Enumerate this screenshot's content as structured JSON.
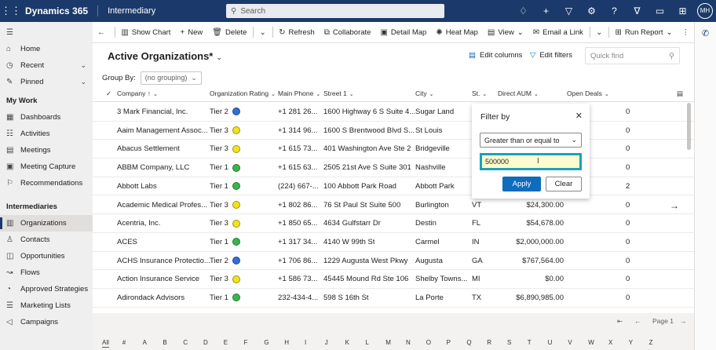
{
  "topbar": {
    "brand": "Dynamics 365",
    "app_name": "Intermediary",
    "search_placeholder": "Search",
    "icons": [
      "lightbulb-icon",
      "plus-icon",
      "filter-icon",
      "gear-icon",
      "help-icon",
      "chevron-down-icon",
      "chat-icon",
      "grid-icon"
    ],
    "avatar_initials": "MH"
  },
  "sidebar": {
    "top_items": [
      {
        "label": "Home",
        "icon": "home-icon"
      },
      {
        "label": "Recent",
        "icon": "clock-icon",
        "has_chevron": true
      },
      {
        "label": "Pinned",
        "icon": "pin-icon",
        "has_chevron": true
      }
    ],
    "sections": [
      {
        "title": "My Work",
        "items": [
          {
            "label": "Dashboards",
            "icon": "dashboard-icon"
          },
          {
            "label": "Activities",
            "icon": "activities-icon"
          },
          {
            "label": "Meetings",
            "icon": "calendar-icon"
          },
          {
            "label": "Meeting Capture",
            "icon": "capture-icon"
          },
          {
            "label": "Recommendations",
            "icon": "recommendation-icon"
          }
        ]
      },
      {
        "title": "Intermediaries",
        "items": [
          {
            "label": "Organizations",
            "icon": "organization-icon",
            "active": true
          },
          {
            "label": "Contacts",
            "icon": "person-icon"
          },
          {
            "label": "Opportunities",
            "icon": "opportunity-icon"
          },
          {
            "label": "Flows",
            "icon": "flow-icon"
          },
          {
            "label": "Approved Strategies",
            "icon": "strategy-icon"
          },
          {
            "label": "Marketing Lists",
            "icon": "list-icon"
          },
          {
            "label": "Campaigns",
            "icon": "campaign-icon"
          }
        ]
      }
    ]
  },
  "commandbar": {
    "items": [
      {
        "label": "Show Chart",
        "icon": "chart-icon"
      },
      {
        "label": "New",
        "icon": "plus-icon"
      },
      {
        "label": "Delete",
        "icon": "trash-icon"
      },
      {
        "label": "Refresh",
        "icon": "refresh-icon"
      },
      {
        "label": "Collaborate",
        "icon": "collaborate-icon"
      },
      {
        "label": "Detail Map",
        "icon": "map-icon"
      },
      {
        "label": "Heat Map",
        "icon": "heatmap-icon"
      },
      {
        "label": "View",
        "icon": "view-icon"
      },
      {
        "label": "Email a Link",
        "icon": "email-icon"
      },
      {
        "label": "Run Report",
        "icon": "report-icon"
      }
    ]
  },
  "view": {
    "title": "Active Organizations*",
    "edit_columns": "Edit columns",
    "edit_filters": "Edit filters",
    "quick_find_placeholder": "Quick find",
    "group_by_label": "Group By:",
    "group_by_value": "(no grouping)"
  },
  "grid": {
    "columns": [
      "Company",
      "Organization Rating",
      "Main Phone",
      "Street 1",
      "City",
      "St.",
      "Direct AUM",
      "Open Deals"
    ],
    "sort_indicator": "↑",
    "rows": [
      {
        "company": "3 Mark Financial, Inc.",
        "rating": "Tier 2",
        "rating_color": "#2f6fd6",
        "phone": "+1 281 26...",
        "street": "1600 Highway 6 S Suite 4...",
        "city": "Sugar Land",
        "state": "",
        "aum": "",
        "deals": "0"
      },
      {
        "company": "Aaim Management Assoc...",
        "rating": "Tier 3",
        "rating_color": "#f4e21c",
        "phone": "+1 314 96...",
        "street": "1600 S Brentwood Blvd S...",
        "city": "St Louis",
        "state": "",
        "aum": "",
        "deals": "0"
      },
      {
        "company": "Abacus Settlement",
        "rating": "Tier 3",
        "rating_color": "#f4e21c",
        "phone": "+1 615 73...",
        "street": "401 Washington Ave Ste 2",
        "city": "Bridgeville",
        "state": "",
        "aum": "",
        "deals": "0"
      },
      {
        "company": "ABBM Company, LLC",
        "rating": "Tier 1",
        "rating_color": "#39b54a",
        "phone": "+1 615 63...",
        "street": "2505 21st Ave S Suite 301",
        "city": "Nashville",
        "state": "",
        "aum": "",
        "deals": "0"
      },
      {
        "company": "Abbott Labs",
        "rating": "Tier 1",
        "rating_color": "#39b54a",
        "phone": "(224) 667-...",
        "street": "100 Abbott Park Road",
        "city": "Abbott Park",
        "state": "",
        "aum": "",
        "deals": "2"
      },
      {
        "company": "Academic Medical Profes...",
        "rating": "Tier 3",
        "rating_color": "#f4e21c",
        "phone": "+1 802 86...",
        "street": "76 St Paul St Suite 500",
        "city": "Burlington",
        "state": "VT",
        "aum": "$24,300.00",
        "deals": "0"
      },
      {
        "company": "Acentria, Inc.",
        "rating": "Tier 3",
        "rating_color": "#f4e21c",
        "phone": "+1 850 65...",
        "street": "4634 Gulfstarr Dr",
        "city": "Destin",
        "state": "FL",
        "aum": "$54,678.00",
        "deals": "0"
      },
      {
        "company": "ACES",
        "rating": "Tier 1",
        "rating_color": "#39b54a",
        "phone": "+1 317 34...",
        "street": "4140 W 99th St",
        "city": "Carmel",
        "state": "IN",
        "aum": "$2,000,000.00",
        "deals": "0"
      },
      {
        "company": "ACHS Insurance Protectio...",
        "rating": "Tier 2",
        "rating_color": "#2f6fd6",
        "phone": "+1 706 86...",
        "street": "1229 Augusta West Pkwy",
        "city": "Augusta",
        "state": "GA",
        "aum": "$767,564.00",
        "deals": "0"
      },
      {
        "company": "Action Insurance Service",
        "rating": "Tier 3",
        "rating_color": "#f4e21c",
        "phone": "+1 586 73...",
        "street": "45445 Mound Rd Ste 106",
        "city": "Shelby Towns...",
        "state": "MI",
        "aum": "$0.00",
        "deals": "0"
      },
      {
        "company": "Adirondack Advisors",
        "rating": "Tier 1",
        "rating_color": "#39b54a",
        "phone": "232-434-4...",
        "street": "598 S 16th St",
        "city": "La Porte",
        "state": "TX",
        "aum": "$6,890,985.00",
        "deals": "0"
      }
    ]
  },
  "filter_panel": {
    "title": "Filter by",
    "operator": "Greater than or equal to",
    "value": "500000",
    "apply_label": "Apply",
    "clear_label": "Clear"
  },
  "pager": {
    "page_label": "Page 1"
  },
  "alphabet": [
    "All",
    "#",
    "A",
    "B",
    "C",
    "D",
    "E",
    "F",
    "G",
    "H",
    "I",
    "J",
    "K",
    "L",
    "M",
    "N",
    "O",
    "P",
    "Q",
    "R",
    "S",
    "T",
    "U",
    "V",
    "W",
    "X",
    "Y",
    "Z"
  ]
}
